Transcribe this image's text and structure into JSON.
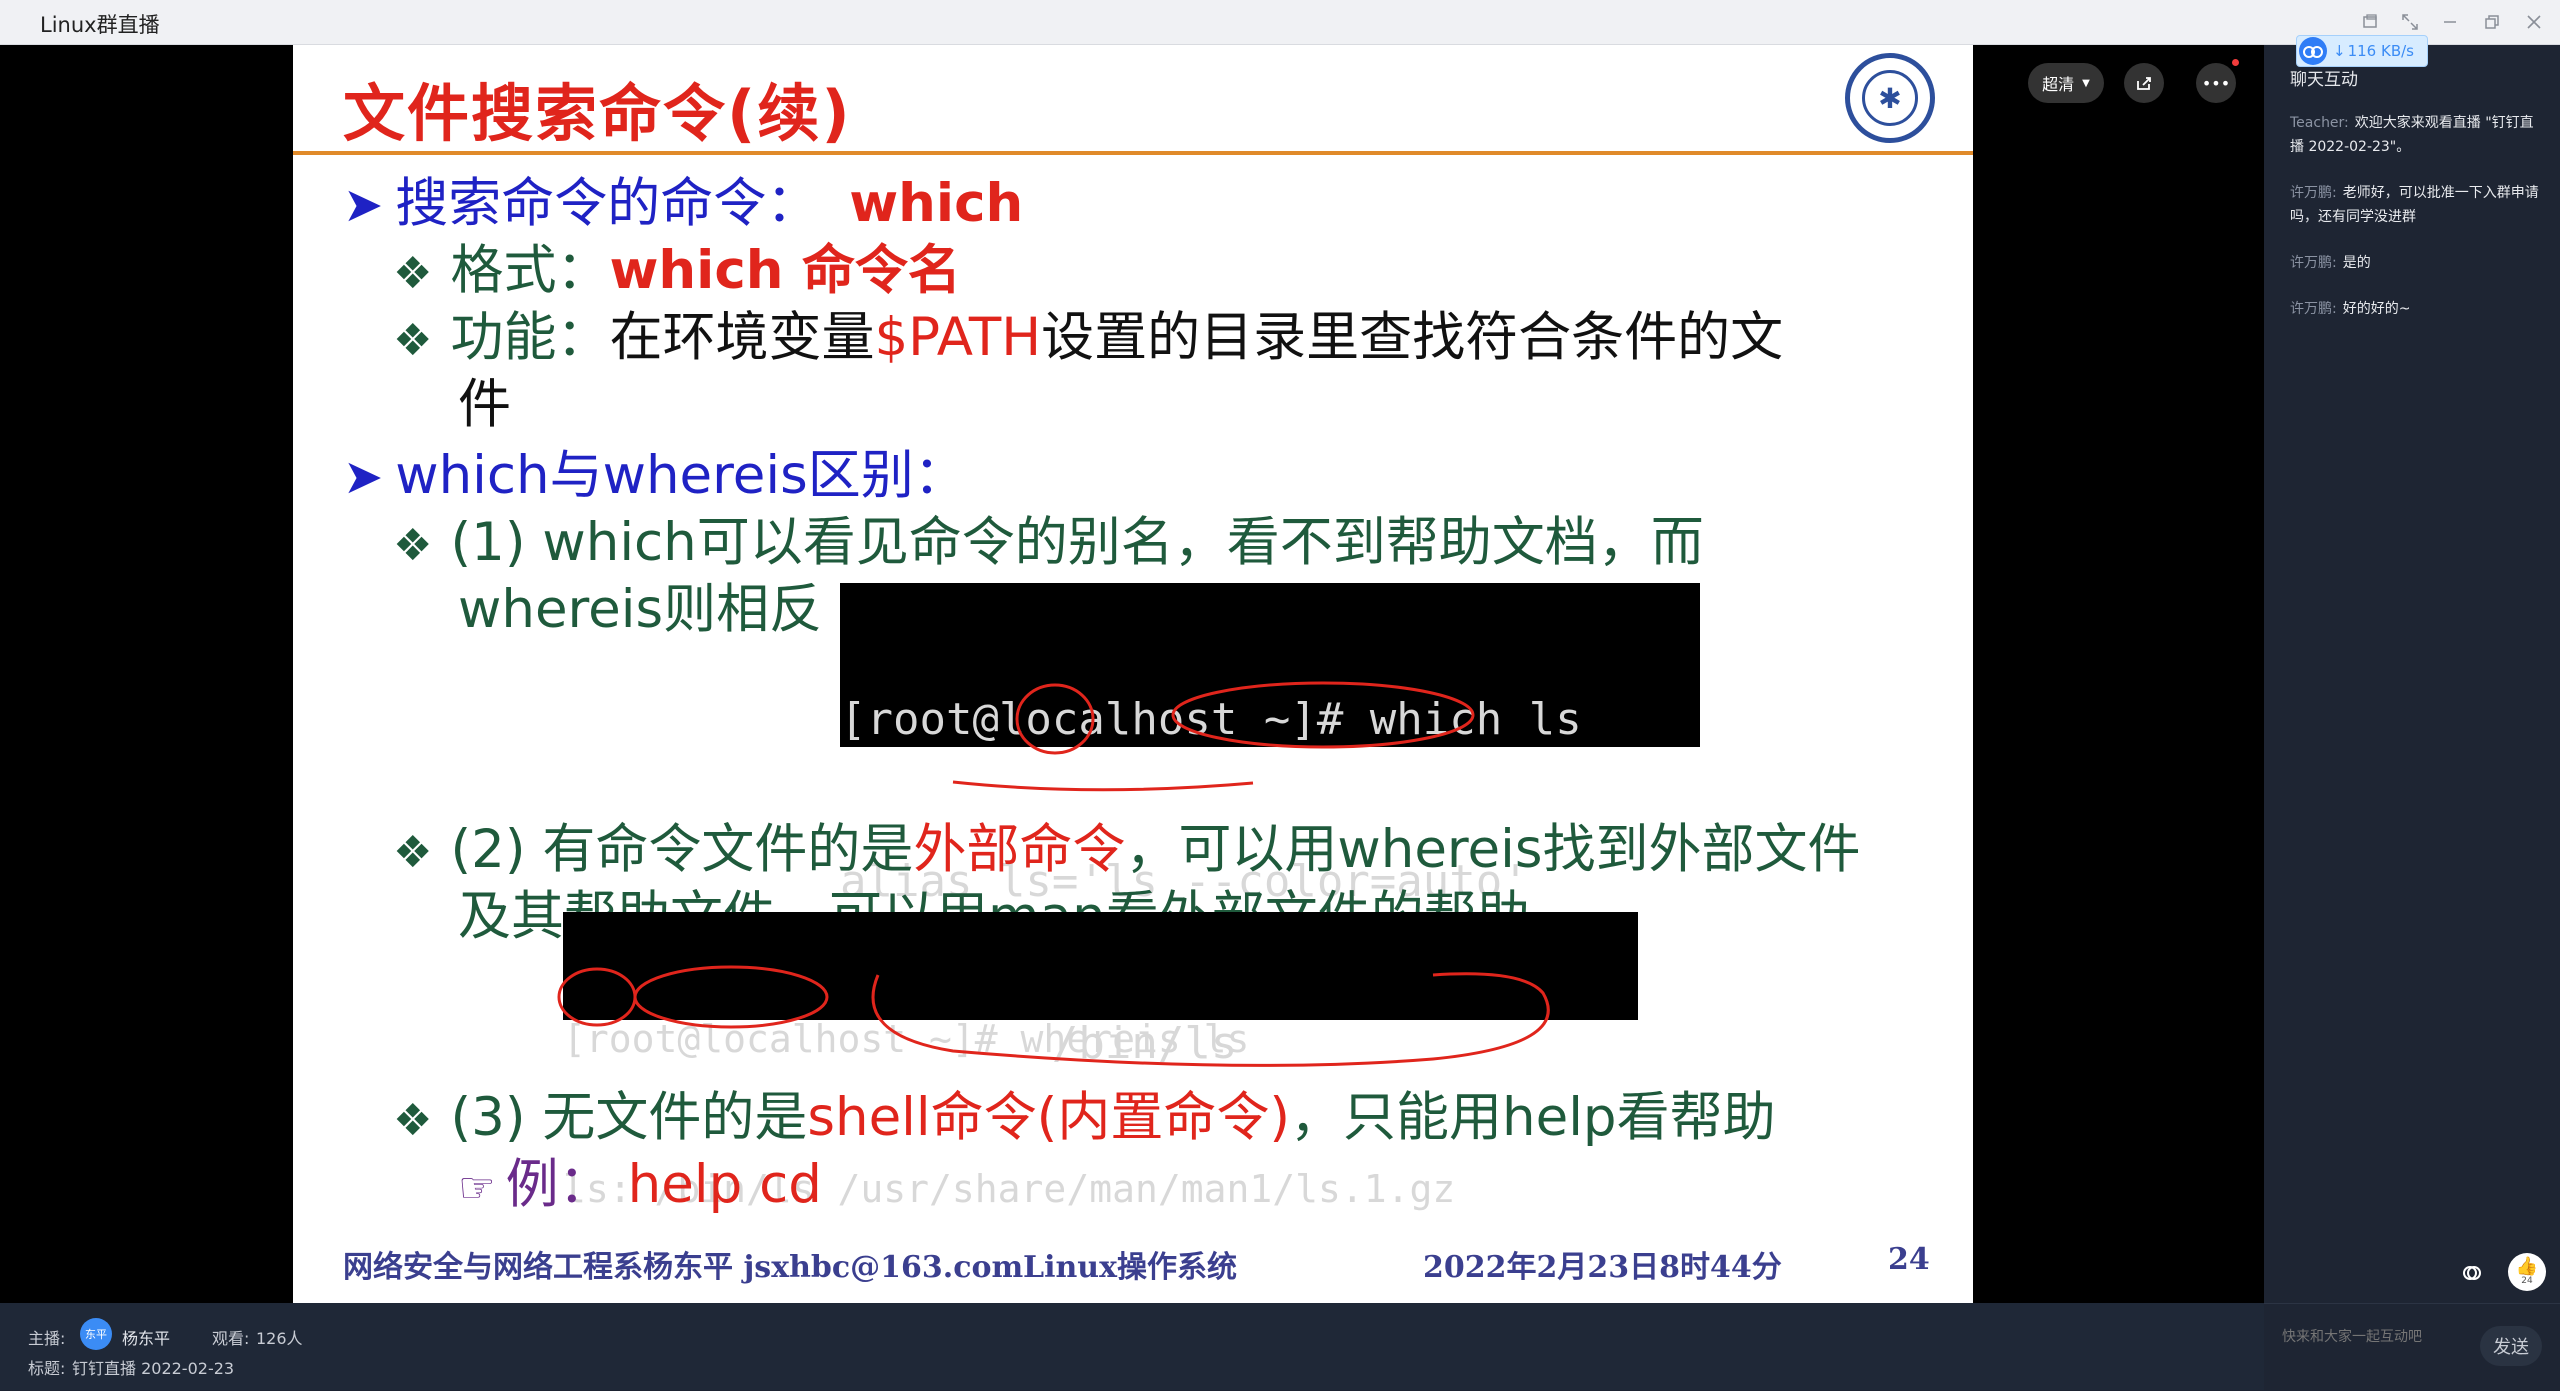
{
  "window": {
    "title": "Linux群直播",
    "speed": "116 KB/s"
  },
  "slide": {
    "title": "文件搜索命令(续)",
    "lines": {
      "l1_label": "搜索命令的命令：",
      "l1_cmd": "which",
      "l2_label": "格式：",
      "l2_value": "which 命令名",
      "l3_label": "功能：",
      "l3_a": "在环境变量",
      "l3_var": "$PATH",
      "l3_b": "设置的目录里查找符合条件的文",
      "l3_c": "件",
      "l4": "which与whereis区别：",
      "l5": "(1) which可以看见命令的别名，看不到帮助文档，而",
      "l6": "whereis则相反",
      "l7_a": "(2) 有命令文件的是",
      "l7_red": "外部命令",
      "l7_b": "，可以用whereis找到外部文件",
      "l8": "及其帮助文件，可以用man看外部文件的帮助",
      "l9_a": "(3) 无文件的是",
      "l9_red": "shell命令(内置命令)",
      "l9_b": "，只能用help看帮助",
      "l10_label": "例：",
      "l10_value": "help cd"
    },
    "term1": [
      "[root@localhost ~]# which ls",
      "alias ls='ls --color=auto'",
      "        /bin/ls"
    ],
    "term2": [
      "[root@localhost ~]# whereis ls",
      "ls: /bin/ls /usr/share/man/man1/ls.1.gz"
    ],
    "footer": {
      "dept": "网络安全与网络工程系杨东平 jsxhbc@163.com",
      "course": "Linux操作系统",
      "date": "2022年2月23日8时44分",
      "page": "24"
    }
  },
  "controls": {
    "quality": "超清",
    "more": "•••"
  },
  "info": {
    "host_label": "主播:",
    "host_avatar": "东平",
    "host_name": "杨东平",
    "viewers_label": "观看:",
    "viewers": "126人",
    "title_label": "标题:",
    "title": "钉钉直播 2022-02-23"
  },
  "chat": {
    "title": "聊天互动",
    "messages": [
      {
        "name": "Teacher:",
        "text": "欢迎大家来观看直播 \"钉钉直播 2022-02-23\"。"
      },
      {
        "name": "许万鹏:",
        "text": "老师好，可以批准一下入群申请吗，还有同学没进群"
      },
      {
        "name": "许万鹏:",
        "text": "是的"
      },
      {
        "name": "许万鹏:",
        "text": "好的好的~"
      }
    ],
    "input_placeholder": "快来和大家一起互动吧",
    "send": "发送",
    "like_count": "24"
  },
  "colors": {
    "slide_title": "#e0251c",
    "blue_text": "#1f22c4",
    "green_text": "#1f5a3c",
    "accent": "#3b8cf5"
  }
}
